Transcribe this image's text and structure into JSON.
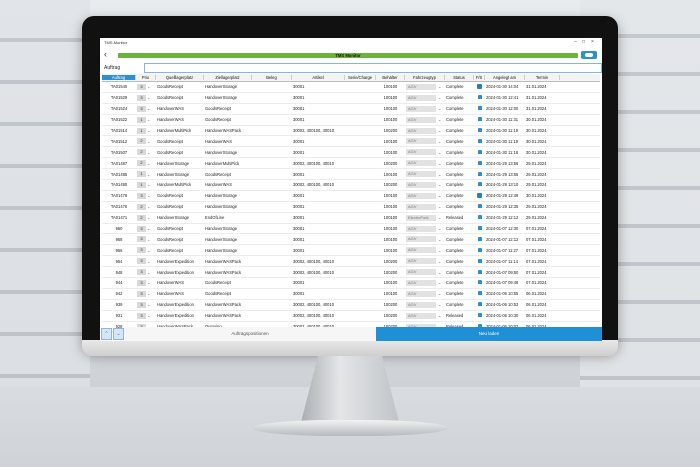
{
  "app": {
    "name": "TMS Monitor",
    "window_title": "TMS-Monitor"
  },
  "search": {
    "label": "Auftrag",
    "placeholder": ""
  },
  "columns": [
    "Auftrag",
    "Prio",
    "Quelllagerplatz",
    "Ziellagerplatz",
    "Beleg",
    "Artikel",
    "Serie/Charge",
    "Behälter",
    "Fahrzeugtyp",
    "Status",
    "F/S",
    "Angelegt am",
    "Termin"
  ],
  "rows": [
    [
      "TA01540",
      "3",
      "GoodsReceipt",
      "HandoverStorage",
      "",
      "30001",
      "",
      "100100",
      "AGV",
      "Complete",
      "task",
      "2024-01-30 14:04",
      "31.01.2024"
    ],
    [
      "TA01529",
      "3",
      "GoodsReceipt",
      "HandoverStorage",
      "",
      "30001",
      "",
      "100100",
      "AGV",
      "Complete",
      "lock",
      "2024-01-30 12:41",
      "31.01.2024"
    ],
    [
      "TA01524",
      "3",
      "HandoverWAS",
      "GoodsReceipt",
      "",
      "30001",
      "",
      "100100",
      "AGV",
      "Complete",
      "lock",
      "2024-01-30 12:00",
      "31.01.2024"
    ],
    [
      "TA01522",
      "1",
      "HandoverWAS",
      "GoodsReceipt",
      "",
      "30001",
      "",
      "100100",
      "AGV",
      "Complete",
      "lock",
      "2024-01-30 11:31",
      "30.01.2024"
    ],
    [
      "TA01514",
      "1",
      "HandoverMultiPick",
      "HandoverWASPack",
      "",
      "30002, 400100, 40010",
      "",
      "100200",
      "AGV",
      "Complete",
      "lock",
      "2024-01-30 11:19",
      "30.01.2024"
    ],
    [
      "TA01512",
      "2",
      "GoodsReceipt",
      "HandoverWAS",
      "",
      "30001",
      "",
      "100100",
      "AGV",
      "Complete",
      "lock",
      "2024-01-30 11:19",
      "30.01.2024"
    ],
    [
      "TA01507",
      "2",
      "GoodsReceipt",
      "HandoverStorage",
      "",
      "30001",
      "",
      "100100",
      "AGV",
      "Complete",
      "lock",
      "2024-01-30 11:18",
      "30.01.2024"
    ],
    [
      "TA01487",
      "2",
      "HandoverStorage",
      "HandoverMultiPick",
      "",
      "30002, 400100, 40010",
      "",
      "100200",
      "AGV",
      "Complete",
      "lock",
      "2024-01-29 13:56",
      "29.01.2024"
    ],
    [
      "TA01485",
      "1",
      "HandoverStorage",
      "GoodsReceipt",
      "",
      "30001",
      "",
      "100100",
      "AGV",
      "Complete",
      "lock",
      "2024-01-29 13:55",
      "29.01.2024"
    ],
    [
      "TA01480",
      "1",
      "HandoverMultiPick",
      "HandoverWAS",
      "",
      "30002, 400100, 40010",
      "",
      "100200",
      "AGV",
      "Complete",
      "lock",
      "2024-01-29 13:10",
      "29.01.2024"
    ],
    [
      "TA01478",
      "3",
      "GoodsReceipt",
      "HandoverStorage",
      "",
      "30001",
      "",
      "100100",
      "AGV",
      "Complete",
      "task",
      "2024-01-29 12:49",
      "30.01.2024"
    ],
    [
      "TA01476",
      "2",
      "GoodsReceipt",
      "HandoverStorage",
      "",
      "30001",
      "",
      "100100",
      "AGV",
      "Complete",
      "lock",
      "2024-01-29 12:35",
      "29.01.2024"
    ],
    [
      "TA01471",
      "2",
      "HandoverStorage",
      "EndOfLine",
      "",
      "30001",
      "",
      "100100",
      "ElectroFork",
      "Released",
      "lock",
      "2024-01-29 12:12",
      "29.01.2024"
    ],
    [
      "960",
      "3",
      "GoodsReceipt",
      "HandoverStorage",
      "",
      "30001",
      "",
      "100100",
      "AGV",
      "Complete",
      "lock",
      "2024-01-07 12:30",
      "07.01.2024"
    ],
    [
      "958",
      "3",
      "GoodsReceipt",
      "HandoverStorage",
      "",
      "30001",
      "",
      "100100",
      "AGV",
      "Complete",
      "lock",
      "2024-01-07 12:12",
      "07.01.2024"
    ],
    [
      "956",
      "3",
      "GoodsReceipt",
      "HandoverStorage",
      "",
      "30001",
      "",
      "100100",
      "AGV",
      "Complete",
      "lock",
      "2024-01-07 11:27",
      "07.01.2024"
    ],
    [
      "954",
      "3",
      "HandoverExpedition",
      "HandoverWASPack",
      "",
      "30002, 400100, 40010",
      "",
      "100200",
      "AGV",
      "Complete",
      "lock",
      "2024-01-07 11:14",
      "07.01.2024"
    ],
    [
      "948",
      "3",
      "HandoverExpedition",
      "HandoverWASPack",
      "",
      "30002, 400100, 40010",
      "",
      "100200",
      "AGV",
      "Complete",
      "lock",
      "2024-01-07 09:50",
      "07.01.2024"
    ],
    [
      "944",
      "3",
      "HandoverWAS",
      "GoodsReceipt",
      "",
      "30001",
      "",
      "100100",
      "AGV",
      "Complete",
      "lock",
      "2024-01-07 09:48",
      "07.01.2024"
    ],
    [
      "942",
      "3",
      "HandoverWAS",
      "GoodsReceipt",
      "",
      "30001",
      "",
      "100100",
      "AGV",
      "Complete",
      "lock",
      "2024-01-06 10:55",
      "06.01.2024"
    ],
    [
      "939",
      "3",
      "HandoverExpedition",
      "HandoverWASPack",
      "",
      "30002, 400100, 40010",
      "",
      "100200",
      "AGV",
      "Complete",
      "lock",
      "2024-01-06 10:53",
      "06.01.2024"
    ],
    [
      "931",
      "3",
      "HandoverExpedition",
      "HandoverWASPack",
      "",
      "30002, 400100, 40010",
      "",
      "100200",
      "AGV",
      "Released",
      "lock",
      "2024-01-06 10:30",
      "06.01.2024"
    ],
    [
      "928",
      "3",
      "HandoverWASPack",
      "Outgoing",
      "",
      "30002, 400100, 40010",
      "",
      "100200",
      "AGV",
      "Released",
      "lock",
      "2024-01-06 10:07",
      "06.01.2024"
    ],
    [
      "926",
      "3",
      "HandoverStorage",
      "HandoverWAS",
      "",
      "30001",
      "",
      "100100",
      "AGV",
      "Complete",
      "lock",
      "2024-01-06 09:44",
      "06.01.2024"
    ]
  ],
  "bottom": {
    "positions_label": "Auftragspositionen",
    "reload_label": "Neu laden",
    "up": "⌃",
    "down": "⌄"
  },
  "colors": {
    "header_green": "#6ab43e",
    "accent_blue": "#1f8fd6"
  }
}
